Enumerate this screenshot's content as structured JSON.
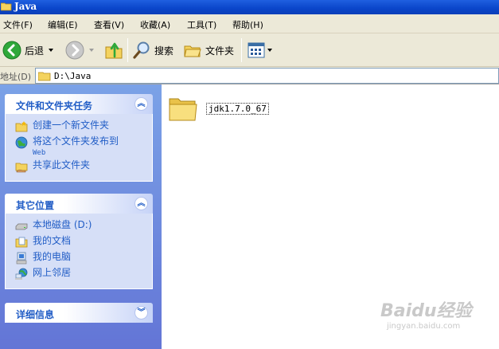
{
  "window": {
    "title": "Java"
  },
  "menu": [
    "文件(F)",
    "编辑(E)",
    "查看(V)",
    "收藏(A)",
    "工具(T)",
    "帮助(H)"
  ],
  "toolbar": {
    "back_label": "后退",
    "search_label": "搜索",
    "folders_label": "文件夹"
  },
  "address": {
    "label": "地址(D)",
    "value": "D:\\Java"
  },
  "task_panels": [
    {
      "title": "文件和文件夹任务",
      "items": [
        "创建一个新文件夹",
        "将这个文件夹发布到",
        "共享此文件夹"
      ],
      "item_sub": "Web"
    },
    {
      "title": "其它位置",
      "items": [
        "本地磁盘 (D:)",
        "我的文档",
        "我的电脑",
        "网上邻居"
      ]
    },
    {
      "title": "详细信息"
    }
  ],
  "files": [
    {
      "name": "jdk1.7.0_67",
      "type": "folder"
    }
  ],
  "watermark": {
    "brand": "Baidu经验",
    "url": "jingyan.baidu.com"
  },
  "colors": {
    "title_bar": "#0a45c9",
    "task_pane": "#6f8ee0",
    "task_link": "#215dc6",
    "chrome": "#ece9d8"
  }
}
